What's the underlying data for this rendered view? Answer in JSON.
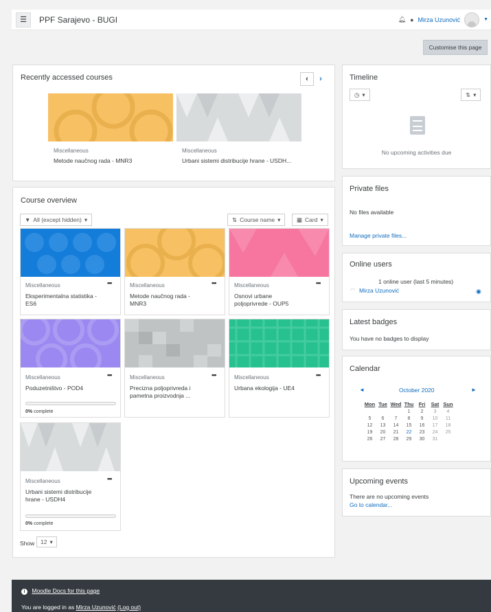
{
  "navbar": {
    "site_name": "PPF Sarajevo - BUGI",
    "user_name": "Mirza Uzunović"
  },
  "customise_label": "Customise this page",
  "recent": {
    "title": "Recently accessed courses",
    "courses": [
      {
        "category": "Miscellaneous",
        "name": "Metode naučnog rada - MNR3"
      },
      {
        "category": "Miscellaneous",
        "name": "Urbani sistemi distribucije hrane - USDH..."
      }
    ]
  },
  "overview": {
    "title": "Course overview",
    "filter_label": "All (except hidden)",
    "sort_label": "Course name",
    "view_label": "Card",
    "courses": [
      {
        "category": "Miscellaneous",
        "name_line1": "Eksperimentalna statistika -",
        "name_line2": "ES6"
      },
      {
        "category": "Miscellaneous",
        "name_line1": "Metode naučnog rada -",
        "name_line2": "MNR3"
      },
      {
        "category": "Miscellaneous",
        "name_line1": "Osnovi urbane",
        "name_line2": "poljoprivrede - OUP5"
      },
      {
        "category": "Miscellaneous",
        "name_line1": "Poduzetništvo - POD4",
        "name_line2": "",
        "progress": "0% complete",
        "progress_value": 0
      },
      {
        "category": "Miscellaneous",
        "name_line1": "Precizna poljoprivreda i",
        "name_line2": "pametna proizvodnja ..."
      },
      {
        "category": "Miscellaneous",
        "name_line1": "Urbana ekologija - UE4",
        "name_line2": ""
      },
      {
        "category": "Miscellaneous",
        "name_line1": "Urbani sistemi distribucije",
        "name_line2": "hrane - USDH4",
        "progress": "0% complete",
        "progress_value": 0
      }
    ],
    "show_label": "Show",
    "show_value": "12"
  },
  "timeline": {
    "title": "Timeline",
    "empty": "No upcoming activities due"
  },
  "private_files": {
    "title": "Private files",
    "empty": "No files available",
    "manage": "Manage private files..."
  },
  "online_users": {
    "title": "Online users",
    "summary": "1 online user (last 5 minutes)",
    "user": "Mirza Uzunović"
  },
  "badges": {
    "title": "Latest badges",
    "empty": "You have no badges to display"
  },
  "calendar": {
    "title": "Calendar",
    "month": "October 2020",
    "days": [
      "Mon",
      "Tue",
      "Wed",
      "Thu",
      "Fri",
      "Sat",
      "Sun"
    ],
    "weeks": [
      [
        "",
        "",
        "",
        "1",
        "2",
        "3",
        "4"
      ],
      [
        "5",
        "6",
        "7",
        "8",
        "9",
        "10",
        "11"
      ],
      [
        "12",
        "13",
        "14",
        "15",
        "16",
        "17",
        "18"
      ],
      [
        "19",
        "20",
        "21",
        "22",
        "23",
        "24",
        "25"
      ],
      [
        "26",
        "27",
        "28",
        "29",
        "30",
        "31",
        ""
      ]
    ],
    "today": "22"
  },
  "upcoming": {
    "title": "Upcoming events",
    "empty": "There are no upcoming events",
    "link": "Go to calendar..."
  },
  "footer": {
    "docs_link": "Moodle Docs for this page",
    "logged_prefix": "You are logged in as",
    "user": "Mirza Uzunović",
    "logout": "(Log out)"
  },
  "colors": {
    "link": "#0f6cbf",
    "footer_bg": "#343a40",
    "orange": "#f7c063",
    "blue": "#137dd9",
    "pink": "#f6769f",
    "purple": "#9b88f0",
    "green": "#27c08f"
  }
}
